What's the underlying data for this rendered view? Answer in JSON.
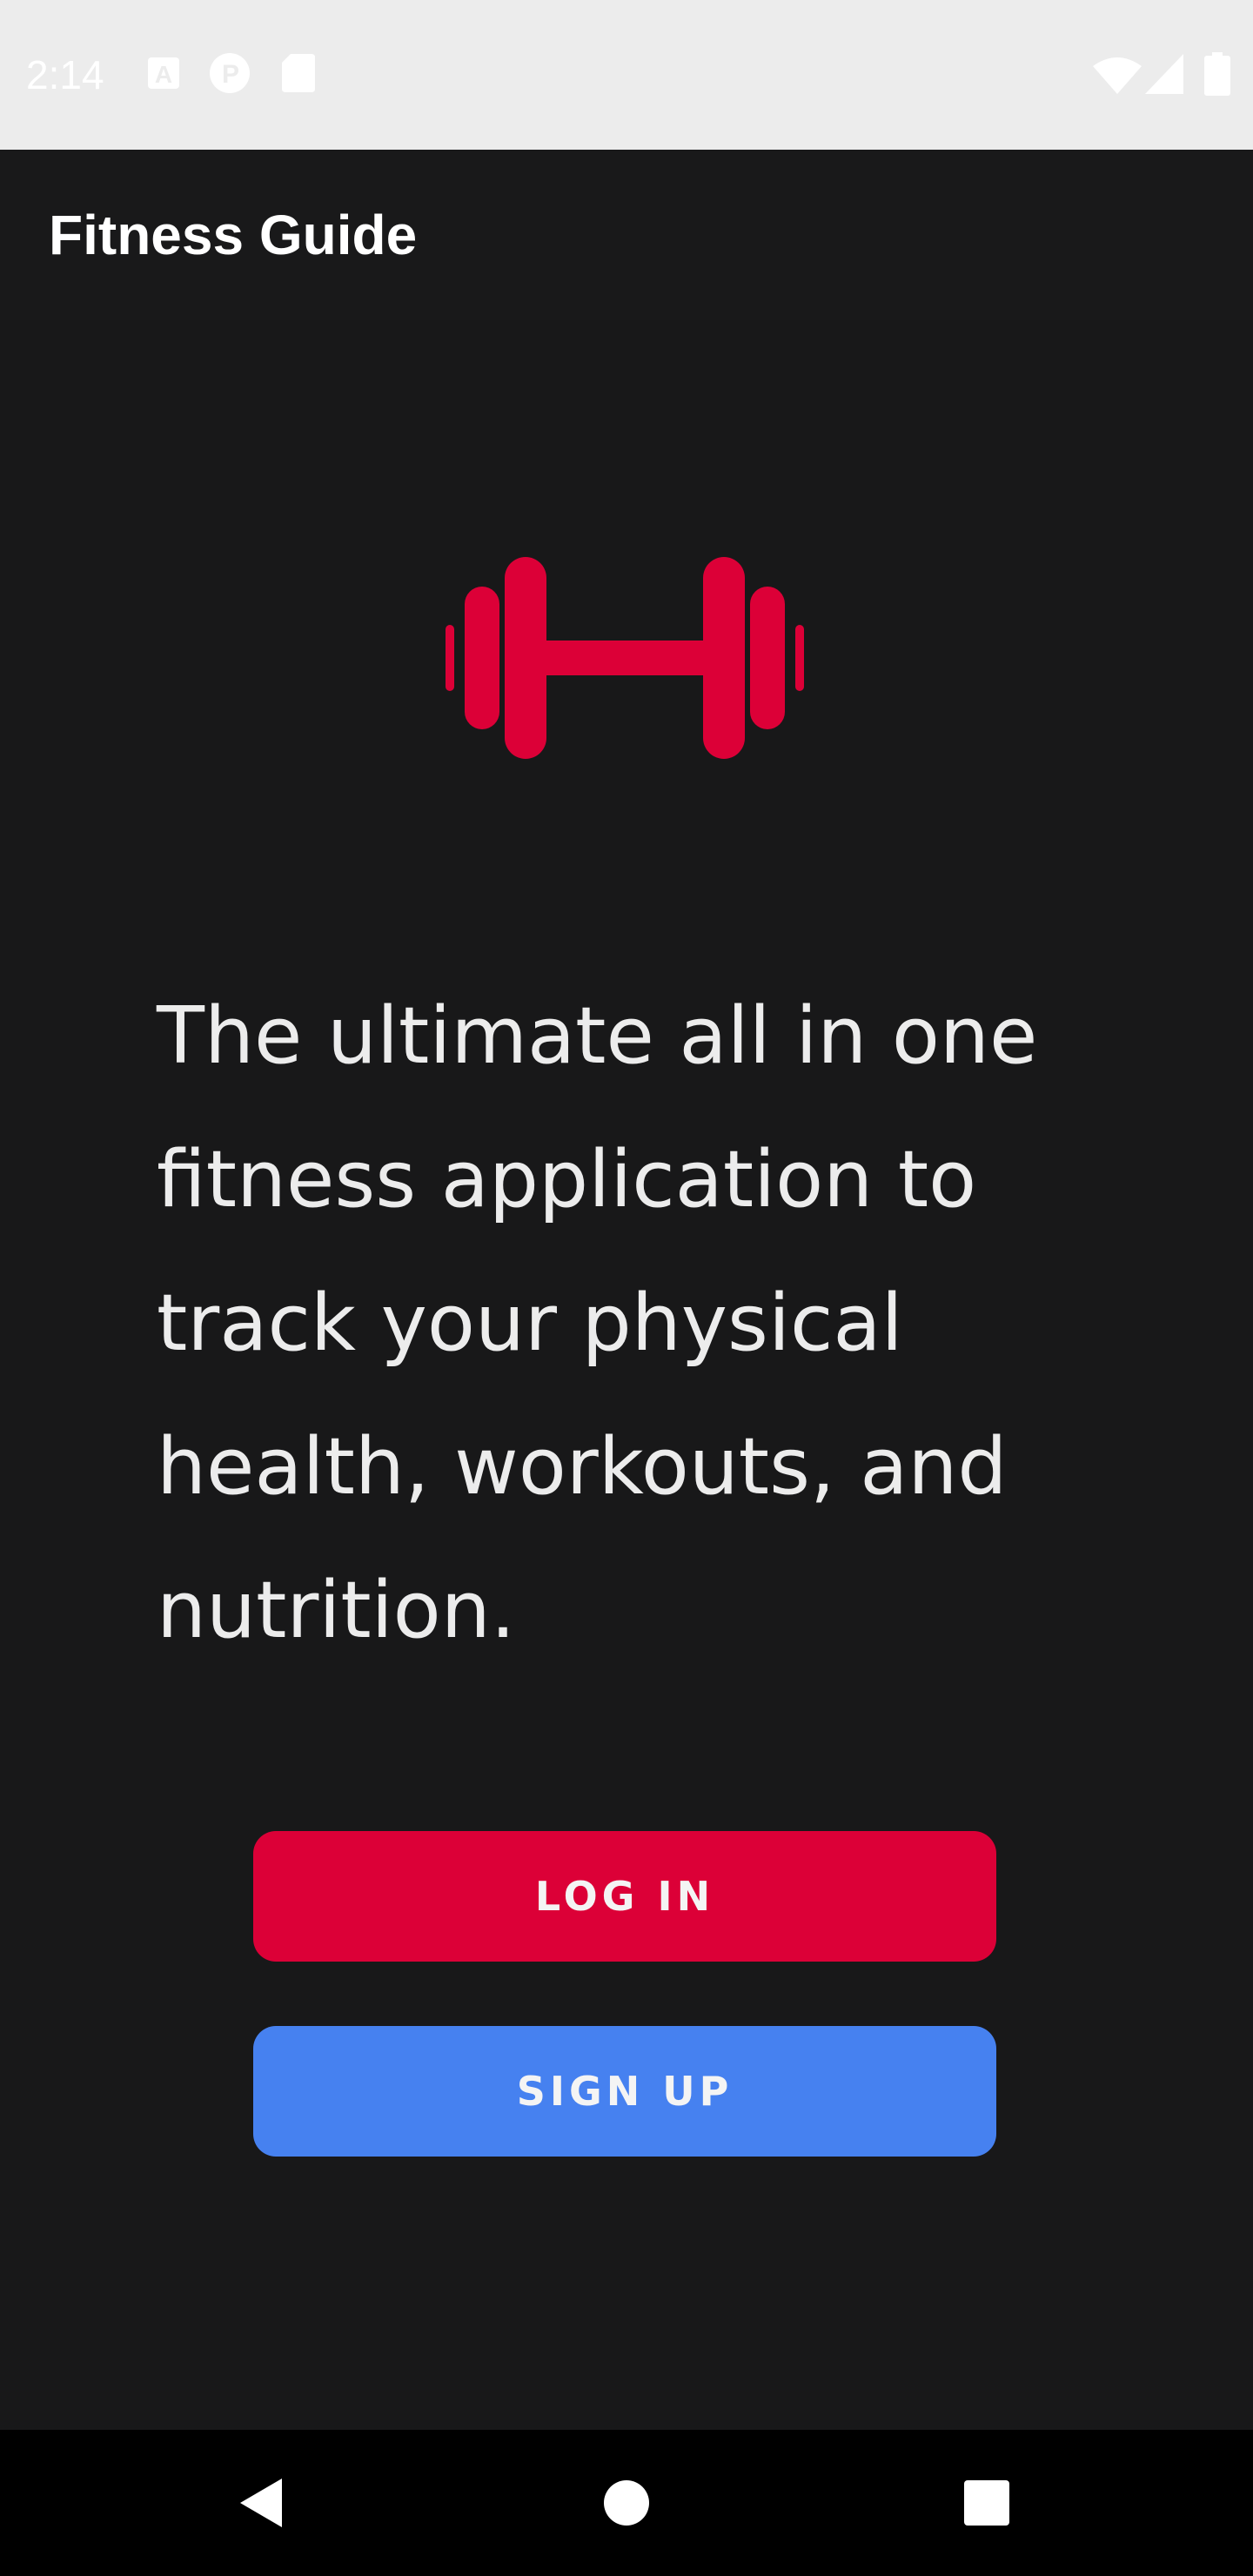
{
  "status_bar": {
    "time": "2:14",
    "icons": [
      "a-notification-icon",
      "p-circle-notification-icon",
      "sd-card-icon",
      "wifi-icon",
      "signal-icon",
      "battery-icon"
    ],
    "background": "#ececec"
  },
  "app_bar": {
    "title": "Fitness Guide",
    "background": "#19191a"
  },
  "logo": {
    "icon": "dumbbell-icon",
    "color": "#dc0037"
  },
  "main": {
    "tagline": "The ultimate all in one fitness application to track your physical health, workouts, and nutrition."
  },
  "buttons": {
    "login": {
      "label": "LOG IN",
      "color": "#dc0037"
    },
    "signup": {
      "label": "SIGN UP",
      "color": "#4681f0"
    }
  },
  "nav_bar": {
    "icons": [
      "back-triangle-icon",
      "home-circle-icon",
      "recents-square-icon"
    ]
  }
}
